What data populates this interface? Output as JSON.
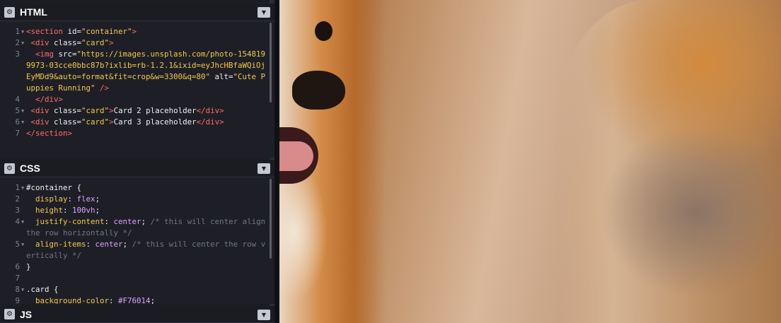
{
  "panels": {
    "html": {
      "title": "HTML",
      "lines": [
        {
          "n": "1",
          "fold": true,
          "segs": [
            [
              "tag",
              "<section "
            ],
            [
              "attr",
              "id="
            ],
            [
              "str",
              "\"container\""
            ],
            [
              "tag",
              ">"
            ]
          ]
        },
        {
          "n": "2",
          "fold": true,
          "segs": [
            [
              "tag",
              " <div "
            ],
            [
              "attr",
              "class="
            ],
            [
              "str",
              "\"card\""
            ],
            [
              "tag",
              ">"
            ]
          ]
        },
        {
          "n": "3",
          "fold": false,
          "segs": [
            [
              "tag",
              "  <img "
            ],
            [
              "attr",
              "src="
            ],
            [
              "str",
              "\"https://images.unsplash.com/photo-1548199973-03cce0bbc87b?ixlib=rb-1.2.1&ixid=eyJhcHBfaWQiOjEyMDd9&auto=format&fit=crop&w=3300&q=80\""
            ],
            [
              "attr",
              " alt="
            ],
            [
              "str",
              "\"Cute Puppies Running\""
            ],
            [
              "tag",
              " />"
            ]
          ]
        },
        {
          "n": "4",
          "fold": false,
          "segs": [
            [
              "tag",
              "  </div>"
            ]
          ]
        },
        {
          "n": "5",
          "fold": true,
          "segs": [
            [
              "tag",
              " <div "
            ],
            [
              "attr",
              "class="
            ],
            [
              "str",
              "\"card\""
            ],
            [
              "tag",
              ">"
            ],
            [
              "attr",
              "Card 2 placeholder"
            ],
            [
              "tag",
              "</div>"
            ]
          ]
        },
        {
          "n": "6",
          "fold": true,
          "segs": [
            [
              "tag",
              " <div "
            ],
            [
              "attr",
              "class="
            ],
            [
              "str",
              "\"card\""
            ],
            [
              "tag",
              ">"
            ],
            [
              "attr",
              "Card 3 placeholder"
            ],
            [
              "tag",
              "</div>"
            ]
          ]
        },
        {
          "n": "7",
          "fold": false,
          "segs": [
            [
              "tag",
              "</section>"
            ]
          ]
        }
      ]
    },
    "css": {
      "title": "CSS",
      "lines": [
        {
          "n": "1",
          "fold": true,
          "segs": [
            [
              "attr",
              "#container {"
            ]
          ]
        },
        {
          "n": "2",
          "fold": false,
          "segs": [
            [
              "prop",
              "  display"
            ],
            [
              "attr",
              ": "
            ],
            [
              "val",
              "flex"
            ],
            [
              "attr",
              ";"
            ]
          ]
        },
        {
          "n": "3",
          "fold": false,
          "segs": [
            [
              "prop",
              "  height"
            ],
            [
              "attr",
              ": "
            ],
            [
              "val",
              "100vh"
            ],
            [
              "attr",
              ";"
            ]
          ]
        },
        {
          "n": "4",
          "fold": true,
          "segs": [
            [
              "prop",
              "  justify-content"
            ],
            [
              "attr",
              ": "
            ],
            [
              "val",
              "center"
            ],
            [
              "attr",
              "; "
            ],
            [
              "cmt",
              "/* this will center align the row horizontally */"
            ]
          ]
        },
        {
          "n": "5",
          "fold": true,
          "segs": [
            [
              "prop",
              "  align-items"
            ],
            [
              "attr",
              ": "
            ],
            [
              "val",
              "center"
            ],
            [
              "attr",
              "; "
            ],
            [
              "cmt",
              "/* this will center the row vertically */"
            ]
          ]
        },
        {
          "n": "6",
          "fold": false,
          "segs": [
            [
              "attr",
              "}"
            ]
          ]
        },
        {
          "n": "7",
          "fold": false,
          "segs": [
            [
              "attr",
              ""
            ]
          ]
        },
        {
          "n": "8",
          "fold": true,
          "segs": [
            [
              "attr",
              ".card {"
            ]
          ]
        },
        {
          "n": "9",
          "fold": false,
          "segs": [
            [
              "prop",
              "  background-color"
            ],
            [
              "attr",
              ": "
            ],
            [
              "val",
              "#F76014"
            ],
            [
              "attr",
              ";"
            ]
          ]
        }
      ]
    },
    "js": {
      "title": "JS"
    }
  },
  "preview": {
    "image_alt": "Cute Puppies Running"
  }
}
